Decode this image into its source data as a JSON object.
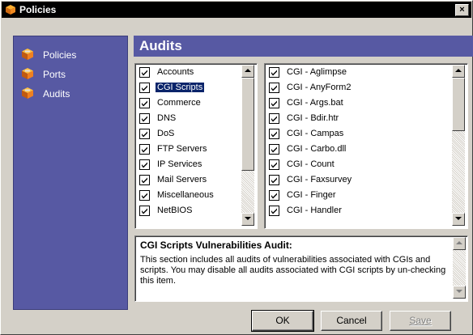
{
  "window": {
    "title": "Policies",
    "close_label": "×"
  },
  "sidebar": {
    "items": [
      {
        "label": "Policies"
      },
      {
        "label": "Ports"
      },
      {
        "label": "Audits"
      }
    ]
  },
  "main": {
    "heading": "Audits",
    "categories": [
      {
        "label": "Accounts",
        "checked": true
      },
      {
        "label": "CGI Scripts",
        "checked": true,
        "selected": true
      },
      {
        "label": "Commerce",
        "checked": true
      },
      {
        "label": "DNS",
        "checked": true
      },
      {
        "label": "DoS",
        "checked": true
      },
      {
        "label": "FTP Servers",
        "checked": true
      },
      {
        "label": "IP Services",
        "checked": true
      },
      {
        "label": "Mail Servers",
        "checked": true
      },
      {
        "label": "Miscellaneous",
        "checked": true
      },
      {
        "label": "NetBIOS",
        "checked": true
      }
    ],
    "audits": [
      {
        "label": "CGI - Aglimpse",
        "checked": true
      },
      {
        "label": "CGI - AnyForm2",
        "checked": true
      },
      {
        "label": "CGI - Args.bat",
        "checked": true
      },
      {
        "label": "CGI - Bdir.htr",
        "checked": true
      },
      {
        "label": "CGI - Campas",
        "checked": true
      },
      {
        "label": "CGI - Carbo.dll",
        "checked": true
      },
      {
        "label": "CGI - Count",
        "checked": true
      },
      {
        "label": "CGI - Faxsurvey",
        "checked": true
      },
      {
        "label": "CGI - Finger",
        "checked": true
      },
      {
        "label": "CGI - Handler",
        "checked": true
      }
    ],
    "description": {
      "title": "CGI Scripts Vulnerabilities Audit:",
      "body": "This section includes all audits of vulnerabilities associated with CGIs and scripts. You may disable all audits associated with CGI scripts by un-checking this item."
    }
  },
  "buttons": {
    "ok": "OK",
    "cancel": "Cancel",
    "save": "Save"
  },
  "colors": {
    "panel": "#5759a3",
    "selection": "#0a246a",
    "face": "#d4d0c8"
  },
  "icons": {
    "title": "policy-cube-icon",
    "nav": "policy-cube-icon"
  }
}
